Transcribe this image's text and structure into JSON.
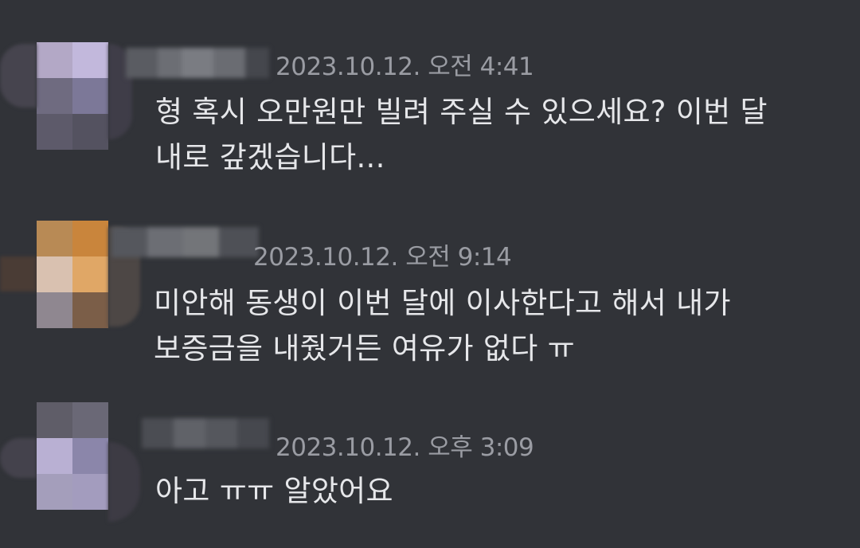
{
  "messages": [
    {
      "timestamp": "2023.10.12. 오전 4:41",
      "lines": [
        "형 혹시 오만원만 빌려 주실 수 있으세요? 이번 달",
        "내로 갚겠습니다..."
      ]
    },
    {
      "timestamp": "2023.10.12. 오전 9:14",
      "lines": [
        "미안해 동생이 이번 달에 이사한다고 해서 내가",
        "보증금을 내줬거든 여유가 없다 ㅠ"
      ]
    },
    {
      "timestamp": "2023.10.12. 오후 3:09",
      "lines": [
        "아고 ㅠㅠ 알았어요"
      ]
    }
  ],
  "colors": {
    "background": "#313338",
    "message_text": "#e6e7ea",
    "timestamp_text": "#9a9ca3"
  }
}
